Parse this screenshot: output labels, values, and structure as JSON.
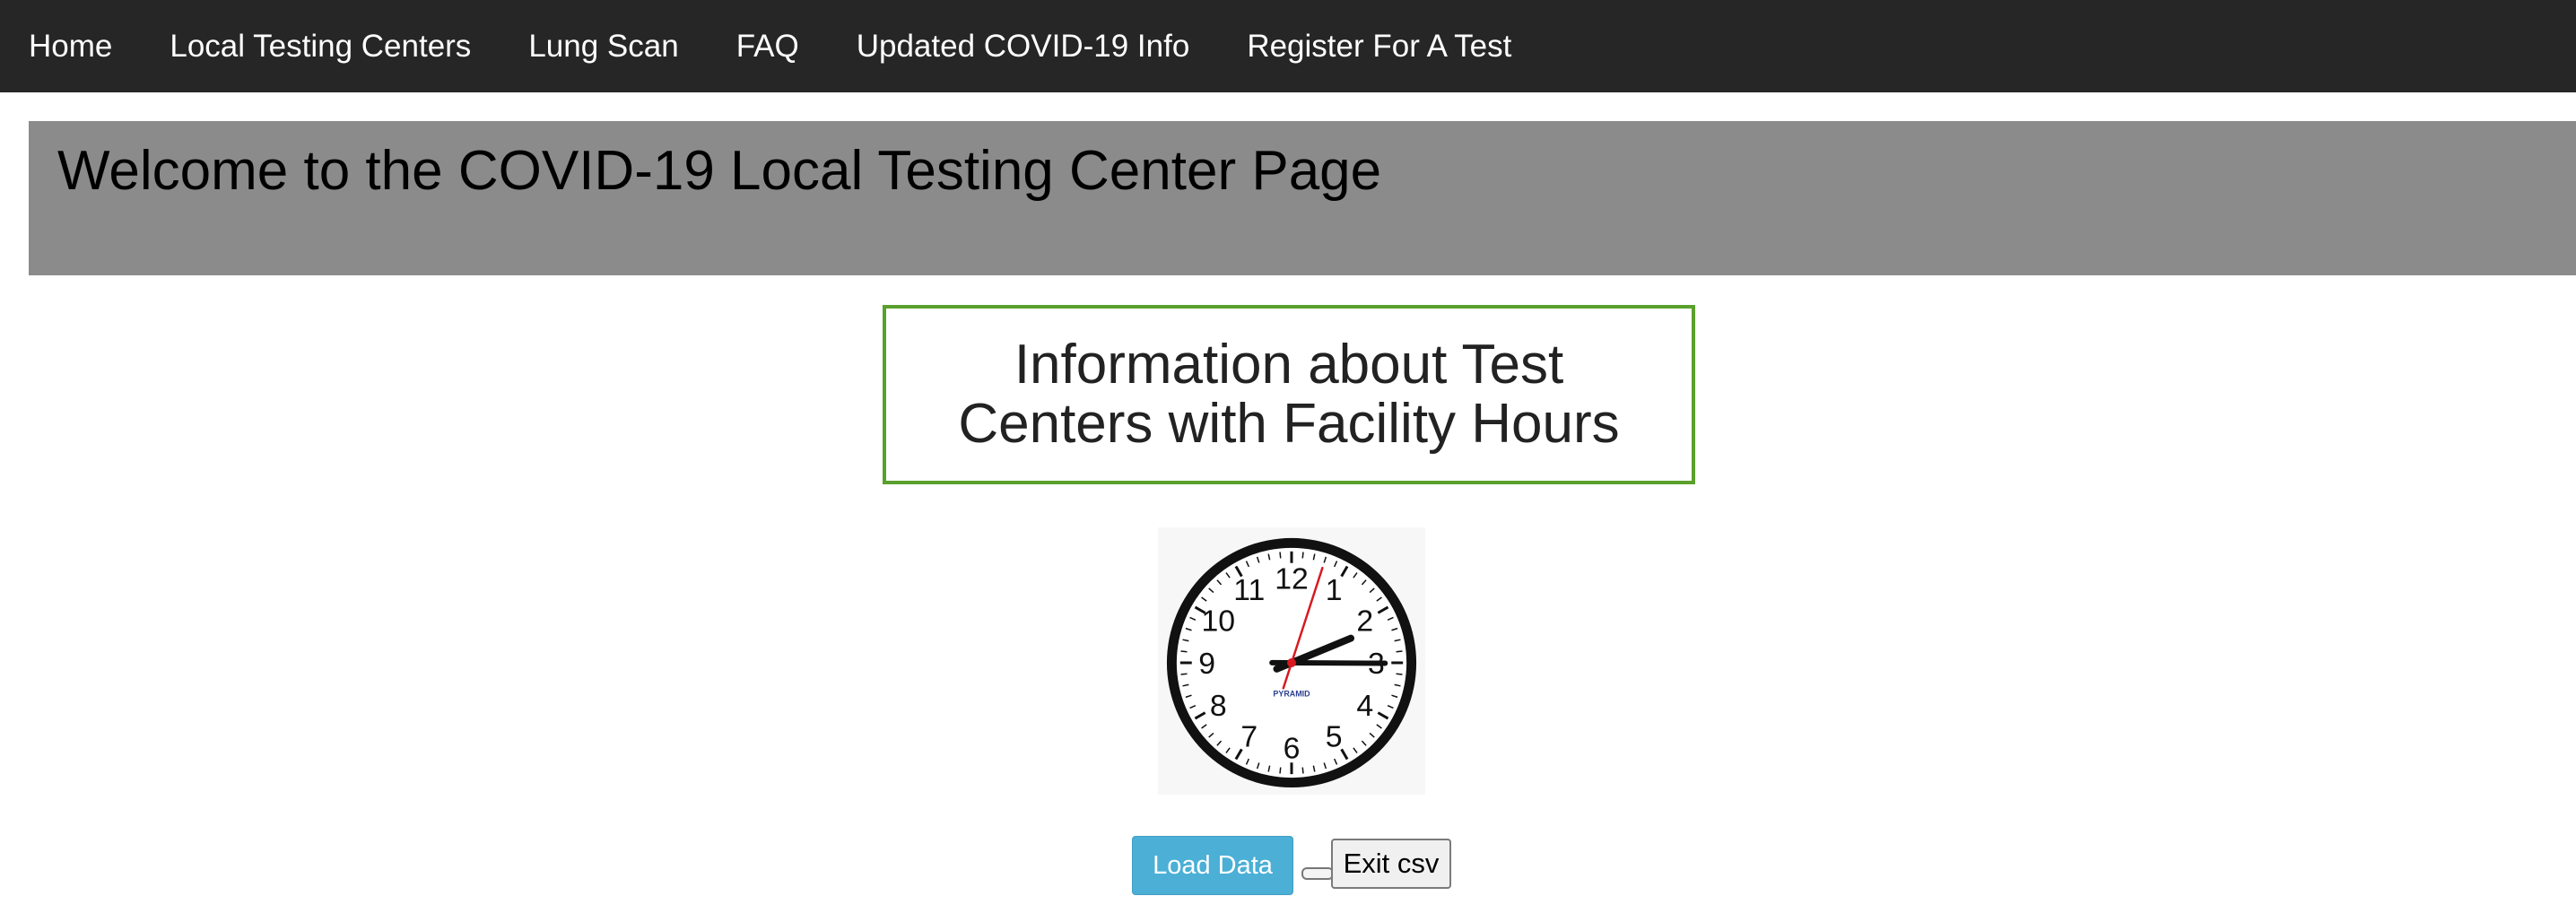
{
  "nav": {
    "items": [
      {
        "label": "Home"
      },
      {
        "label": "Local Testing Centers"
      },
      {
        "label": "Lung Scan"
      },
      {
        "label": "FAQ"
      },
      {
        "label": "Updated COVID-19 Info"
      },
      {
        "label": "Register For A Test"
      }
    ]
  },
  "banner": {
    "title": "Welcome to the COVID-19 Local Testing Center Page"
  },
  "info": {
    "heading": "Information about Test Centers with Facility Hours"
  },
  "clock": {
    "brand": "PYRAMID",
    "numbers": [
      "12",
      "1",
      "2",
      "3",
      "4",
      "5",
      "6",
      "7",
      "8",
      "9",
      "10",
      "11"
    ],
    "time": {
      "hour": 2,
      "minute": 15,
      "second": 3
    }
  },
  "actions": {
    "load_label": "Load Data",
    "exit_label": "Exit csv"
  },
  "colors": {
    "nav_bg": "#262626",
    "banner_bg": "#8b8b8b",
    "box_border": "#5aa02c",
    "load_button": "#4bafd6"
  }
}
